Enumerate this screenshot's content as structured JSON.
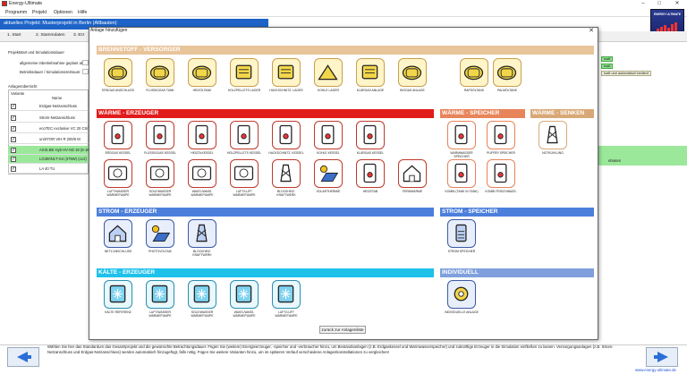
{
  "app": {
    "title": "Energy-Ultimate",
    "minimize": "–",
    "maximize": "□",
    "close": "✕"
  },
  "menu": [
    "Programm",
    "Projekt",
    "Optionen",
    "Hilfe"
  ],
  "logo": {
    "text": "ENERGY ULTIMATE"
  },
  "project_bar": {
    "label": "aktuelles Projekt: Musterprojekt in Berlin (Altbauten)"
  },
  "tabs": [
    "1. Start",
    "2. Stammdaten",
    "3. Erz"
  ],
  "background": {
    "section_label": "Projektstart und Simulationsdauer",
    "field1_label": "allgemeine Inbetriebnahme geplant ab:",
    "field2_label": "Betriebsdauer / Simulationszeitraum:",
    "btn1": "kraft",
    "btn2": "kraft",
    "btn3": "kraft und automatisch bedient",
    "anlagen_label": "Anlagenübersicht",
    "col_variante": "Variante",
    "col_name": "Name",
    "rows": [
      "Erdgas-Netzanschluss",
      "Strom-Netzanschluss",
      "ecoTEC exclusive VC 20 CS/1-7",
      "uniSTOR VIH R 200/6 M",
      "AXIS.BE Hyb HV-SD 18 (8-18)",
      "LG300N1T-G4 (375W) (x12)",
      "LA 40 TU"
    ],
    "side_label": "ebraten"
  },
  "status": {
    "text": "Wählen Sie hier das Standardum das Gesamtprojekt und die gewünschte Betrachtungsdauer. Fügen Sie (weitere) Energieerzeuger, -speicher und -verbraucher hinzu, um Bestandsanlagen (z.B. Erdgaskessel und Warmwasserspeicher) und zukünftige Erzeuger in die Simulation einfließen zu lassen. Versorgungsanlagen (z.B. Strom-Netzanschluss und Erdgas-Netzanschluss) werden automatisch hinzugefügt, falls nötig. Fügen Sie weitere Varianten hinzu, um im späteren Verlauf verschiedene Anlagenkonstellationen zu vergleichen!",
    "url": "www.energy-ultimate.de"
  },
  "dialog": {
    "title": "Anlage hinzufügen",
    "back": "zurück zur Anlagenliste",
    "sections": {
      "brennstoff": "BRENNSTOFF - VERSORGER",
      "waerme_erz": "WÄRME - ERZEUGER",
      "waerme_sp": "WÄRME - SPEICHER",
      "waerme_se": "WÄRME - SENKEN",
      "strom_erz": "STROM - ERZEUGER",
      "strom_sp": "STROM - SPEICHER",
      "kaelte": "KÄLTE - ERZEUGER",
      "individuell": "INDIVIDUELL"
    },
    "brennstoff_items": [
      "ERDGAS ANSCHLUSS",
      "FLÜSSIGGAS TANK",
      "HEIZÖLTANK",
      "HOLZPELLETS LAGER",
      "HACKSCHNITZ. LAGER",
      "KOHLE LAGER",
      "KLÄRGAS ANLAGE",
      "BIOGAS ANLAGE",
      "RAPSÖLTANK",
      "PALMÖLTANK"
    ],
    "waerme_row1": [
      "ERDGAS KESSEL",
      "FLÜSSIGGAS KESSEL",
      "HEIZÖLKESSEL",
      "HOLZPELLETS KESSEL",
      "HACKSCHNITZ. KESSEL",
      "KOHLE KESSEL",
      "KLÄRGAS KESSEL"
    ],
    "waerme_row2": [
      "LUFT/WASSER WÄRMEPUMPE",
      "SOLE/WASSER WÄRMEPUMPE",
      "WASS./WASS. WÄRMEPUMPE",
      "LUFT/LUFT WÄRMEPUMPE",
      "BLOCKHEIZ. KRAFTWERK",
      "SOLARTHERMIE",
      "HEIZSTAB",
      "FERNWÄRME"
    ],
    "speicher_items": [
      "WARMWASSER SPEICHER",
      "PUFFER SPEICHER",
      "KOMBI (TANK IN TANK)",
      "KOMBI FRISCHWASS."
    ],
    "senken_items": [
      "NOTKÜHLUNG"
    ],
    "strom_items": [
      "NETZ ANSCHLUSS",
      "PHOTOVOLTAIK",
      "BLOCKHEIZ. KRAFTWERK"
    ],
    "strom_sp_items": [
      "STROM SPEICHER"
    ],
    "kaelte_items": [
      "KÄLTE REFERENZ",
      "LUFT/WASSER WÄRMEPUMPE",
      "SOLE/WASSER WÄRMEPUMPE",
      "WASS./WASS. WÄRMEPUMPE",
      "LUFT/LUFT WÄRMEPUMPE"
    ],
    "indiv_items": [
      "INDIVIDUELLE ANLAGE"
    ],
    "colors": {
      "brennstoff": "#e8c49a",
      "waerme_erz": "#e21b1b",
      "waerme_sp": "#e8845a",
      "waerme_se": "#d9a876",
      "strom": "#4c7fdc",
      "kaelte": "#1ec1ea",
      "individuell": "#7fa0dc"
    }
  }
}
